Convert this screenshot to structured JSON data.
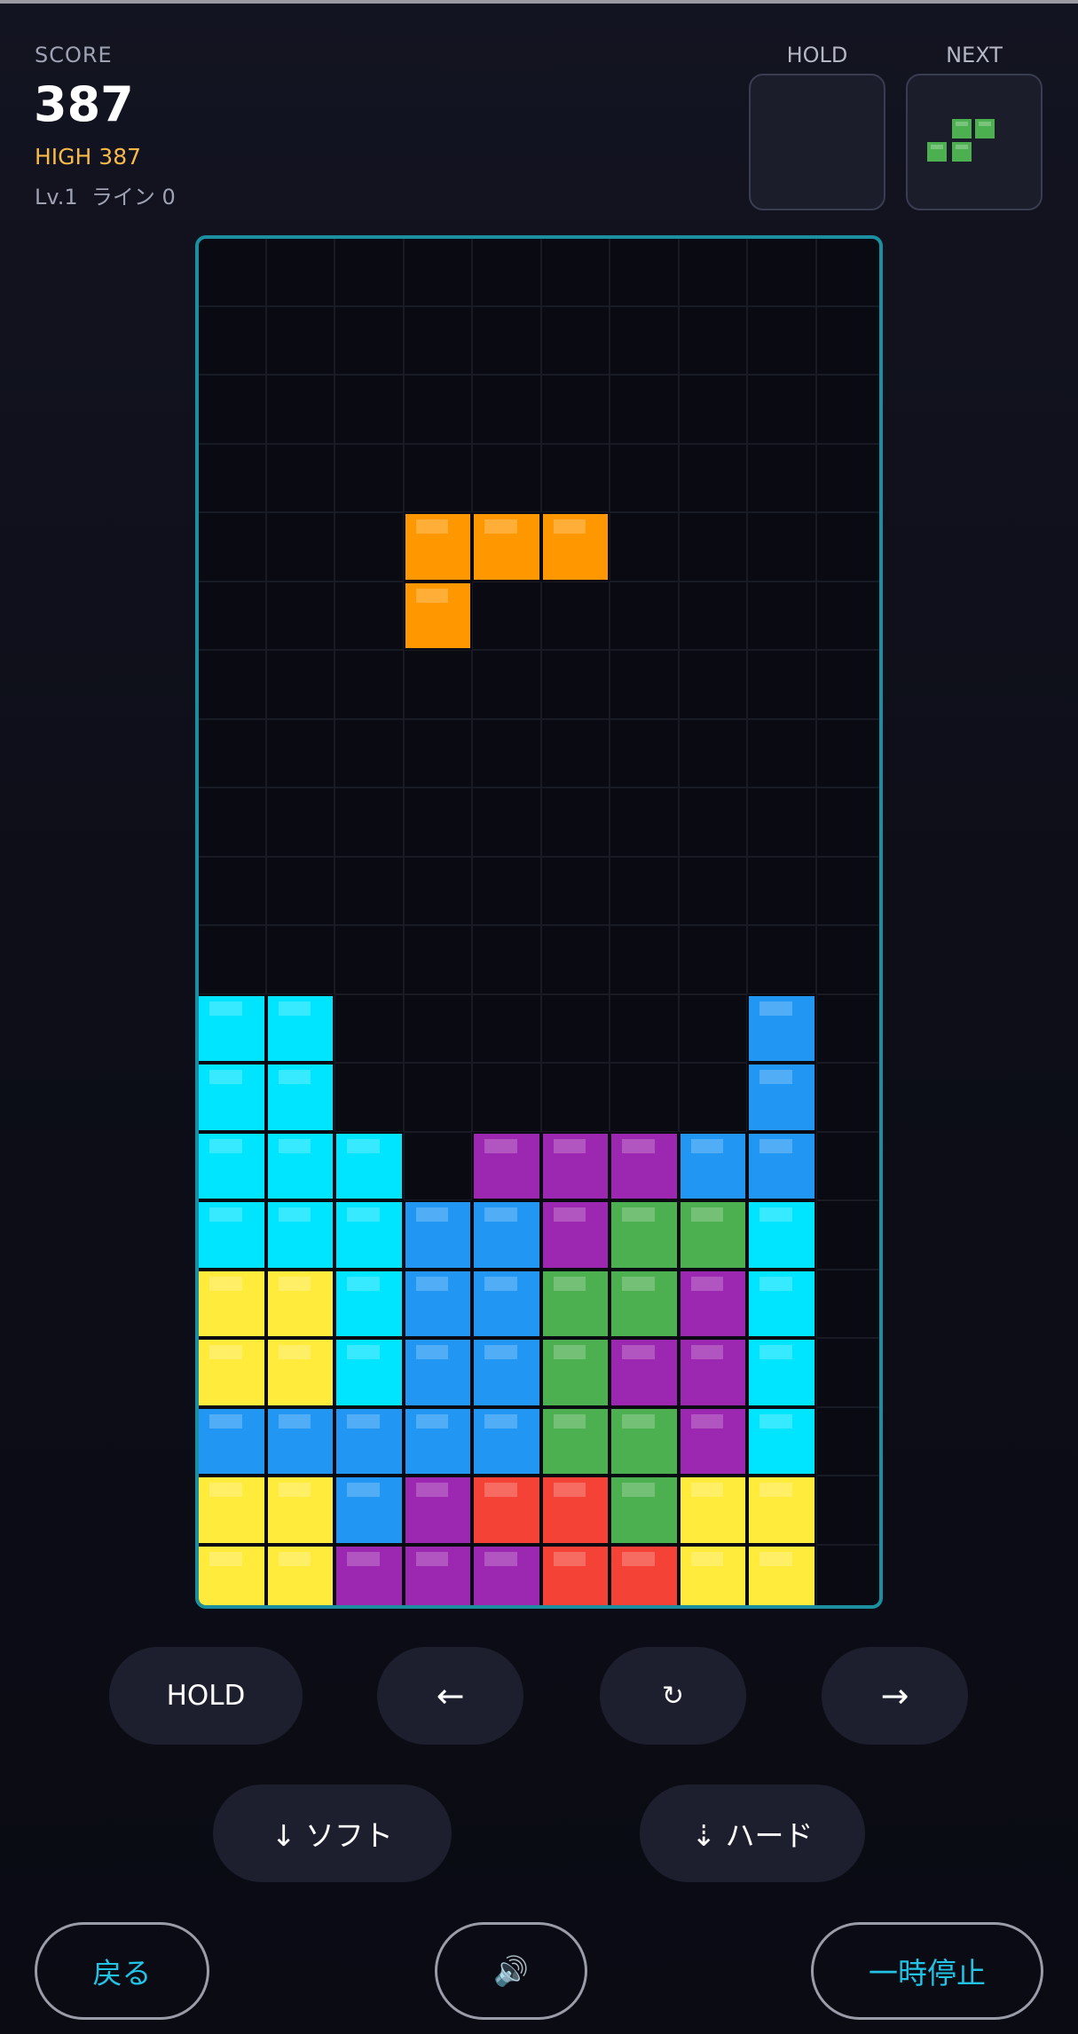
{
  "header": {
    "score_label": "SCORE",
    "score_value": "387",
    "high_score": "HIGH 387",
    "level_line": "Lv.1  ライン 0",
    "hold_label": "HOLD",
    "next_label": "NEXT"
  },
  "hold_piece": null,
  "next_piece": {
    "type": "S",
    "color": "#4caf50"
  },
  "board": {
    "columns": 10,
    "rows": 20,
    "colors": {
      "I": "#00e5ff",
      "O": "#ffeb3b",
      "J": "#2196f3",
      "L": "#ff9800",
      "T": "#9c27b0",
      "S": "#4caf50",
      "Z": "#f44336"
    },
    "active_piece": {
      "type": "L",
      "cells": [
        [
          4,
          3
        ],
        [
          4,
          4
        ],
        [
          4,
          5
        ],
        [
          5,
          3
        ]
      ]
    },
    "stack_rows": [
      "..........",
      "..........",
      "..........",
      "..........",
      "..........",
      "..........",
      "..........",
      "..........",
      "..........",
      "..........",
      "..........",
      "II......J.",
      "II......J.",
      "III.TTTJJ.",
      "IIIJJTSSI.",
      "OOIJJSSTI.",
      "OOIJJSTTI.",
      "JJJJJSSTI.",
      "OOJTZZSOO.",
      "OOTTTZZOO."
    ]
  },
  "controls": {
    "hold": "HOLD",
    "left": "←",
    "rotate": "↻",
    "right": "→",
    "soft_drop": "↓ ソフト",
    "hard_drop": "⇣ ハード",
    "back": "戻る",
    "sound_icon": "🔊",
    "pause": "一時停止"
  }
}
